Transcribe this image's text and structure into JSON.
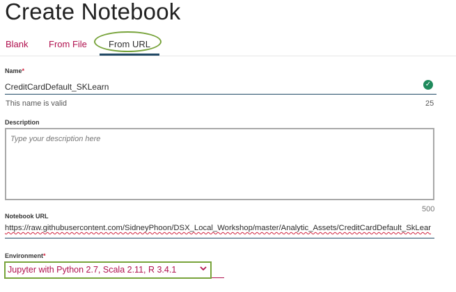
{
  "page": {
    "title": "Create Notebook"
  },
  "tabs": [
    {
      "label": "Blank",
      "active": false
    },
    {
      "label": "From File",
      "active": false
    },
    {
      "label": "From URL",
      "active": true
    }
  ],
  "form": {
    "name": {
      "label": "Name",
      "required_mark": "*",
      "value": "CreditCardDefault_SKLearn",
      "validation_message": "This name is valid",
      "remaining_chars": "25",
      "status_icon": "check-circle-icon"
    },
    "description": {
      "label": "Description",
      "placeholder": "Type your description here",
      "value": "",
      "remaining_chars": "500"
    },
    "notebook_url": {
      "label": "Notebook URL",
      "value": "https://raw.githubusercontent.com/SidneyPhoon/DSX_Local_Workshop/master/Analytic_Assets/CreditCardDefault_SkLear"
    },
    "environment": {
      "label": "Environment",
      "required_mark": "*",
      "selected": "Jupyter with Python 2.7, Scala 2.11, R 3.4.1",
      "icon": "chevron-down-icon"
    }
  },
  "colors": {
    "accent": "#b0104e",
    "active_underline": "#214a66",
    "success": "#1f8a5c",
    "annotation_highlight": "#77a33a",
    "required": "#d0213c"
  }
}
